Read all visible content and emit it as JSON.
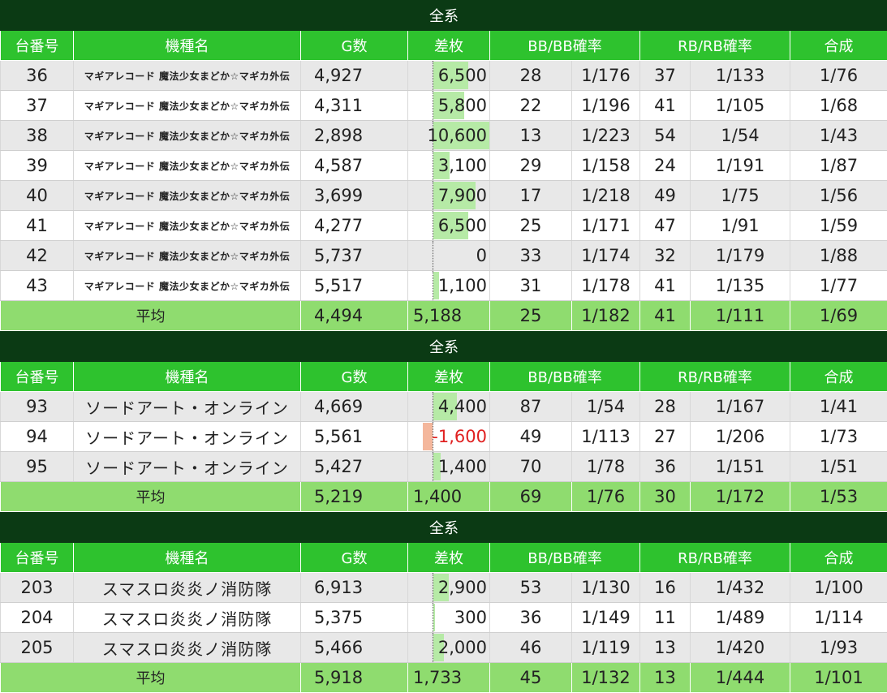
{
  "headers": {
    "machine_no": "台番号",
    "name": "機種名",
    "games": "G数",
    "diff": "差枚",
    "bb": "BB/BB確率",
    "rb": "RB/RB確率",
    "combined": "合成"
  },
  "sections": [
    {
      "title": "全系",
      "name_size": "small",
      "rows": [
        {
          "no": "36",
          "name": "マギアレコード 魔法少女まどか☆マギカ外伝",
          "g": "4,927",
          "diff": "6,500",
          "diff_value": 6500,
          "bb": "28",
          "bb_p": "1/176",
          "rb": "37",
          "rb_p": "1/133",
          "comb": "1/76"
        },
        {
          "no": "37",
          "name": "マギアレコード 魔法少女まどか☆マギカ外伝",
          "g": "4,311",
          "diff": "5,800",
          "diff_value": 5800,
          "bb": "22",
          "bb_p": "1/196",
          "rb": "41",
          "rb_p": "1/105",
          "comb": "1/68"
        },
        {
          "no": "38",
          "name": "マギアレコード 魔法少女まどか☆マギカ外伝",
          "g": "2,898",
          "diff": "10,600",
          "diff_value": 10600,
          "bb": "13",
          "bb_p": "1/223",
          "rb": "54",
          "rb_p": "1/54",
          "comb": "1/43"
        },
        {
          "no": "39",
          "name": "マギアレコード 魔法少女まどか☆マギカ外伝",
          "g": "4,587",
          "diff": "3,100",
          "diff_value": 3100,
          "bb": "29",
          "bb_p": "1/158",
          "rb": "24",
          "rb_p": "1/191",
          "comb": "1/87"
        },
        {
          "no": "40",
          "name": "マギアレコード 魔法少女まどか☆マギカ外伝",
          "g": "3,699",
          "diff": "7,900",
          "diff_value": 7900,
          "bb": "17",
          "bb_p": "1/218",
          "rb": "49",
          "rb_p": "1/75",
          "comb": "1/56"
        },
        {
          "no": "41",
          "name": "マギアレコード 魔法少女まどか☆マギカ外伝",
          "g": "4,277",
          "diff": "6,500",
          "diff_value": 6500,
          "bb": "25",
          "bb_p": "1/171",
          "rb": "47",
          "rb_p": "1/91",
          "comb": "1/59"
        },
        {
          "no": "42",
          "name": "マギアレコード 魔法少女まどか☆マギカ外伝",
          "g": "5,737",
          "diff": "0",
          "diff_value": 0,
          "bb": "33",
          "bb_p": "1/174",
          "rb": "32",
          "rb_p": "1/179",
          "comb": "1/88"
        },
        {
          "no": "43",
          "name": "マギアレコード 魔法少女まどか☆マギカ外伝",
          "g": "5,517",
          "diff": "1,100",
          "diff_value": 1100,
          "bb": "31",
          "bb_p": "1/178",
          "rb": "41",
          "rb_p": "1/135",
          "comb": "1/77"
        }
      ],
      "avg": {
        "label": "平均",
        "g": "4,494",
        "diff": "5,188",
        "bb": "25",
        "bb_p": "1/182",
        "rb": "41",
        "rb_p": "1/111",
        "comb": "1/69"
      }
    },
    {
      "title": "全系",
      "name_size": "large",
      "rows": [
        {
          "no": "93",
          "name": "ソードアート・オンライン",
          "g": "4,669",
          "diff": "4,400",
          "diff_value": 4400,
          "bb": "87",
          "bb_p": "1/54",
          "rb": "28",
          "rb_p": "1/167",
          "comb": "1/41"
        },
        {
          "no": "94",
          "name": "ソードアート・オンライン",
          "g": "5,561",
          "diff": "-1,600",
          "diff_value": -1600,
          "bb": "49",
          "bb_p": "1/113",
          "rb": "27",
          "rb_p": "1/206",
          "comb": "1/73"
        },
        {
          "no": "95",
          "name": "ソードアート・オンライン",
          "g": "5,427",
          "diff": "1,400",
          "diff_value": 1400,
          "bb": "70",
          "bb_p": "1/78",
          "rb": "36",
          "rb_p": "1/151",
          "comb": "1/51"
        }
      ],
      "avg": {
        "label": "平均",
        "g": "5,219",
        "diff": "1,400",
        "bb": "69",
        "bb_p": "1/76",
        "rb": "30",
        "rb_p": "1/172",
        "comb": "1/53"
      }
    },
    {
      "title": "全系",
      "name_size": "large",
      "rows": [
        {
          "no": "203",
          "name": "スマスロ炎炎ノ消防隊",
          "g": "6,913",
          "diff": "2,900",
          "diff_value": 2900,
          "bb": "53",
          "bb_p": "1/130",
          "rb": "16",
          "rb_p": "1/432",
          "comb": "1/100"
        },
        {
          "no": "204",
          "name": "スマスロ炎炎ノ消防隊",
          "g": "5,375",
          "diff": "300",
          "diff_value": 300,
          "bb": "36",
          "bb_p": "1/149",
          "rb": "11",
          "rb_p": "1/489",
          "comb": "1/114"
        },
        {
          "no": "205",
          "name": "スマスロ炎炎ノ消防隊",
          "g": "5,466",
          "diff": "2,000",
          "diff_value": 2000,
          "bb": "46",
          "bb_p": "1/119",
          "rb": "13",
          "rb_p": "1/420",
          "comb": "1/93"
        }
      ],
      "avg": {
        "label": "平均",
        "g": "5,918",
        "diff": "1,733",
        "bb": "45",
        "bb_p": "1/132",
        "rb": "13",
        "rb_p": "1/444",
        "comb": "1/101"
      }
    }
  ],
  "colors": {
    "title_bg": "#0b3a14",
    "header_bg": "#2ec22e",
    "avg_bg": "#8fdc6f",
    "bar_pos": "#b6eaa6",
    "bar_neg": "#f4b79c",
    "negative_text": "#e02020"
  }
}
